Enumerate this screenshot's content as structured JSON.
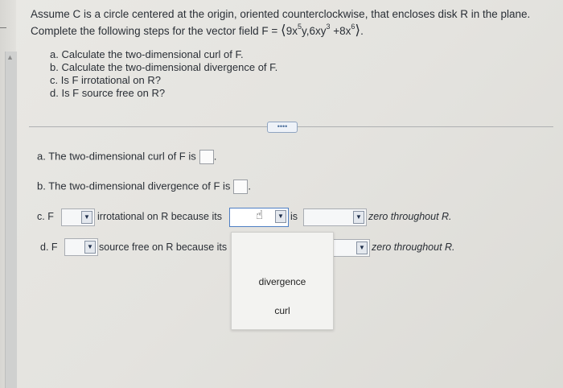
{
  "question": {
    "line1": "Assume C is a circle centered at the origin, oriented counterclockwise, that encloses disk R in the plane.",
    "line2_prefix": "Complete the following steps for the vector field F =",
    "field": {
      "open": "⟨",
      "t1": "9x",
      "e1": "5",
      "t2": "y,6xy",
      "e2": "3",
      "t3": " +8x",
      "e3": "6",
      "close": "⟩",
      "end": "."
    }
  },
  "steps": [
    "a. Calculate the two-dimensional curl of F.",
    "b. Calculate the two-dimensional divergence of F.",
    "c. Is F irrotational on R?",
    "d. Is F source free on R?"
  ],
  "expand_label": "••••",
  "answers": {
    "a_label": "a. The two-dimensional curl of F is",
    "a_end": ".",
    "b_label": "b. The two-dimensional divergence of F is",
    "b_end": ".",
    "c": {
      "prefix": "c. F",
      "mid": "irrotational on R because its",
      "is": "is",
      "suffix": "zero throughout R."
    },
    "d": {
      "prefix": "d. F",
      "mid": "source free on R because its",
      "suffix": "zero throughout R."
    }
  },
  "dropdown_arrow": "▼",
  "popup_options": [
    "divergence",
    "curl"
  ]
}
